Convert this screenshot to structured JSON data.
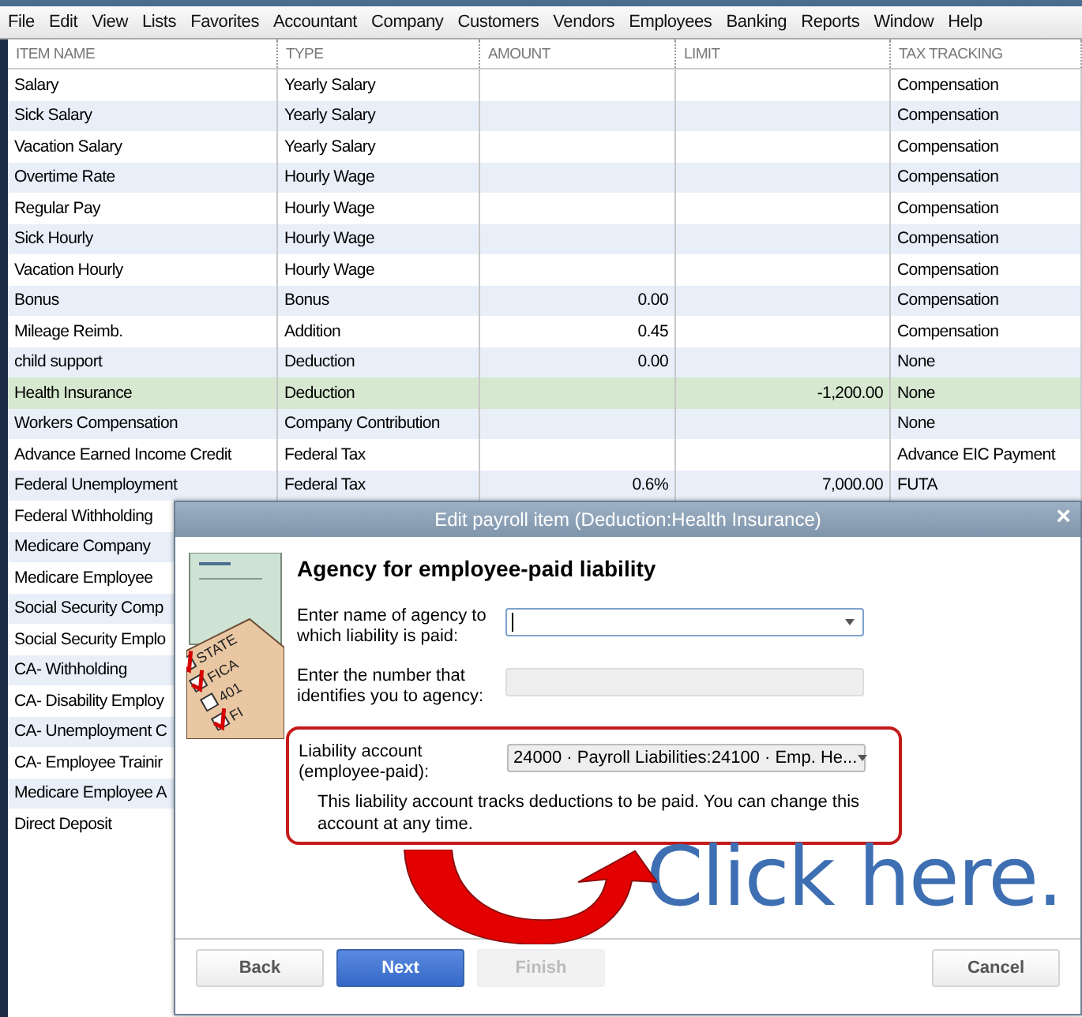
{
  "menu": [
    "File",
    "Edit",
    "View",
    "Lists",
    "Favorites",
    "Accountant",
    "Company",
    "Customers",
    "Vendors",
    "Employees",
    "Banking",
    "Reports",
    "Window",
    "Help"
  ],
  "table": {
    "columns": [
      "ITEM NAME",
      "TYPE",
      "AMOUNT",
      "LIMIT",
      "TAX TRACKING"
    ],
    "rows": [
      {
        "cells": [
          "Salary",
          "Yearly Salary",
          "",
          "",
          "Compensation"
        ],
        "selected": false
      },
      {
        "cells": [
          "Sick Salary",
          "Yearly Salary",
          "",
          "",
          "Compensation"
        ],
        "selected": false
      },
      {
        "cells": [
          "Vacation Salary",
          "Yearly Salary",
          "",
          "",
          "Compensation"
        ],
        "selected": false
      },
      {
        "cells": [
          "Overtime Rate",
          "Hourly Wage",
          "",
          "",
          "Compensation"
        ],
        "selected": false
      },
      {
        "cells": [
          "Regular Pay",
          "Hourly Wage",
          "",
          "",
          "Compensation"
        ],
        "selected": false
      },
      {
        "cells": [
          "Sick Hourly",
          "Hourly Wage",
          "",
          "",
          "Compensation"
        ],
        "selected": false
      },
      {
        "cells": [
          "Vacation Hourly",
          "Hourly Wage",
          "",
          "",
          "Compensation"
        ],
        "selected": false
      },
      {
        "cells": [
          "Bonus",
          "Bonus",
          "0.00",
          "",
          "Compensation"
        ],
        "selected": false
      },
      {
        "cells": [
          "Mileage Reimb.",
          "Addition",
          "0.45",
          "",
          "Compensation"
        ],
        "selected": false
      },
      {
        "cells": [
          "child support",
          "Deduction",
          "0.00",
          "",
          "None"
        ],
        "selected": false
      },
      {
        "cells": [
          "Health Insurance",
          "Deduction",
          "",
          "-1,200.00",
          "None"
        ],
        "selected": true
      },
      {
        "cells": [
          "Workers Compensation",
          "Company Contribution",
          "",
          "",
          "None"
        ],
        "selected": false
      },
      {
        "cells": [
          "Advance Earned Income Credit",
          "Federal Tax",
          "",
          "",
          "Advance EIC Payment"
        ],
        "selected": false
      },
      {
        "cells": [
          "Federal Unemployment",
          "Federal Tax",
          "0.6%",
          "7,000.00",
          "FUTA"
        ],
        "selected": false
      },
      {
        "cells": [
          "Federal Withholding"
        ],
        "selected": false
      },
      {
        "cells": [
          "Medicare Company"
        ],
        "selected": false
      },
      {
        "cells": [
          "Medicare Employee"
        ],
        "selected": false
      },
      {
        "cells": [
          "Social Security Comp"
        ],
        "selected": false
      },
      {
        "cells": [
          "Social Security Emplo"
        ],
        "selected": false
      },
      {
        "cells": [
          "CA- Withholding"
        ],
        "selected": false
      },
      {
        "cells": [
          "CA- Disability Employ"
        ],
        "selected": false
      },
      {
        "cells": [
          "CA- Unemployment C"
        ],
        "selected": false
      },
      {
        "cells": [
          "CA- Employee Trainir"
        ],
        "selected": false
      },
      {
        "cells": [
          "Medicare Employee A"
        ],
        "selected": false
      },
      {
        "cells": [
          "Direct Deposit"
        ],
        "selected": false
      }
    ]
  },
  "dialog": {
    "title": "Edit payroll item (Deduction:Health Insurance)",
    "close": "×",
    "illustration_labels": [
      "STATE",
      "FICA",
      "401",
      "FI"
    ],
    "heading": "Agency for employee-paid liability",
    "fields": [
      {
        "label": "Enter name of agency to which liability is paid:",
        "kind": "dropdown",
        "focused": true,
        "highlighted": false
      },
      {
        "label": "Enter the number that identifies you to agency:",
        "kind": "text",
        "focused": false,
        "highlighted": false
      },
      {
        "label": "Liability account (employee-paid):",
        "value": "24000 · Payroll Liabilities:24100 · Emp. He...",
        "kind": "dropdown",
        "focused": false,
        "highlighted": true
      }
    ],
    "note": "This liability account tracks deductions to be paid. You can change this account at any time.",
    "callout": "Click here.",
    "buttons": [
      {
        "label": "Back",
        "primary": false,
        "disabled": false
      },
      {
        "label": "Next",
        "primary": true,
        "disabled": false
      },
      {
        "label": "Finish",
        "primary": false,
        "disabled": true
      },
      {
        "label": "Cancel",
        "primary": false,
        "disabled": false
      }
    ]
  }
}
